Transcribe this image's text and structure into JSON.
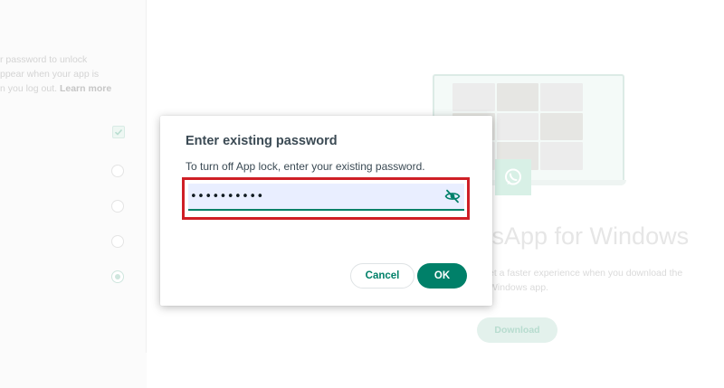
{
  "background": {
    "description_lines": [
      "r password to unlock",
      "ppear when your app is",
      "n you log out."
    ],
    "learn_more": "Learn more",
    "promo_title": "tsApp for Windows",
    "promo_sub_lines": [
      "et a faster experience when you download the",
      "Windows app."
    ],
    "download_label": "Download"
  },
  "dialog": {
    "title": "Enter existing password",
    "description": "To turn off App lock, enter your existing password.",
    "password_value": "••••••••••",
    "cancel_label": "Cancel",
    "ok_label": "OK"
  },
  "icons": {
    "visibility_toggle": "eye-off-icon",
    "checkbox": "checkmark-icon",
    "badge": "whatsapp-icon"
  },
  "colors": {
    "accent": "#008069",
    "highlight_border": "#cf1f26",
    "input_bg": "#e9eeff",
    "text": "#3b4a54"
  }
}
